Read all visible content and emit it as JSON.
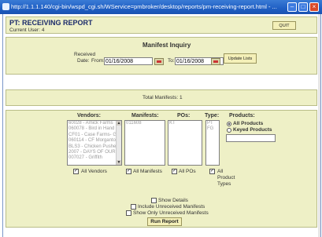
{
  "window": {
    "title": "http://1.1.1.140/cgi-bin/wspd_cgi.sh/WService=pmbroker/desktop/reports/pm-receiving-report.html - ..."
  },
  "header": {
    "title": "PT: RECEIVING REPORT",
    "current_user": "Current User: 4",
    "quit_label": "QUIT"
  },
  "manifest_inquiry": {
    "heading": "Manifest Inquiry",
    "received_label": "Received",
    "date_label": "Date:",
    "from_label": "From:",
    "from_value": "01/16/2008",
    "to_label": "To:",
    "to_value": "01/16/2008",
    "update_button": "Update Lists"
  },
  "totals": {
    "text": "Total Manifests: 1"
  },
  "filters": {
    "vendors_heading": "Vendors:",
    "manifests_heading": "Manifests:",
    "pos_heading": "POs:",
    "type_heading": "Type:",
    "products_heading": "Products:",
    "vendors": [
      "60028 - Amick Farms",
      "060078 - Bird in Hand",
      "CF01 - Case Farms- Goldsb",
      "060114 - CF Morganton",
      "BLS3 - Chicken Pusher",
      "2007 - DAYS OF OUR LIVE",
      "007027 - Griffith"
    ],
    "manifests": [
      "011608"
    ],
    "pos": [
      "KT"
    ],
    "types": [
      "PT",
      "FG"
    ],
    "all_vendors_label": "All Vendors",
    "all_manifests_label": "All Manifests",
    "all_pos_label": "All POs",
    "all_product_types_label": "All Product Types",
    "product_options": [
      "All Products",
      "Keyed Products"
    ]
  },
  "options": {
    "show_details": "Show Details",
    "include_unreceived": "Include Unreceived Manifests",
    "show_only_unreceived": "Show Only Unreceived Manifests",
    "run_button": "Run Report"
  },
  "icons": {
    "calendar": "calendar-icon",
    "minimize": "minimize-icon",
    "maximize": "maximize-icon",
    "close": "close-icon"
  }
}
